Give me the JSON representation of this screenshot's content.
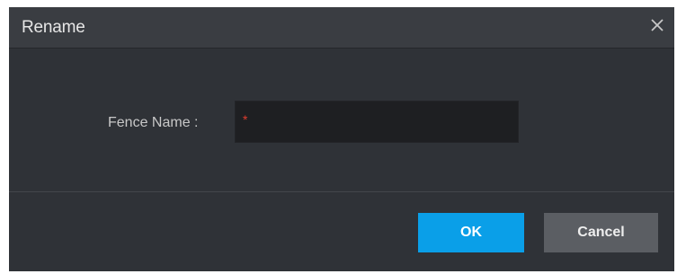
{
  "dialog": {
    "title": "Rename",
    "close_icon": "close-icon"
  },
  "form": {
    "field_label": "Fence Name :",
    "required_mark": "*",
    "field_value": "",
    "field_placeholder": ""
  },
  "buttons": {
    "ok_label": "OK",
    "cancel_label": "Cancel"
  },
  "colors": {
    "ok_button": "#0a9fe8",
    "cancel_button": "#5b5e63",
    "required_mark": "#e03c2f",
    "dialog_bg": "#2f3237"
  }
}
